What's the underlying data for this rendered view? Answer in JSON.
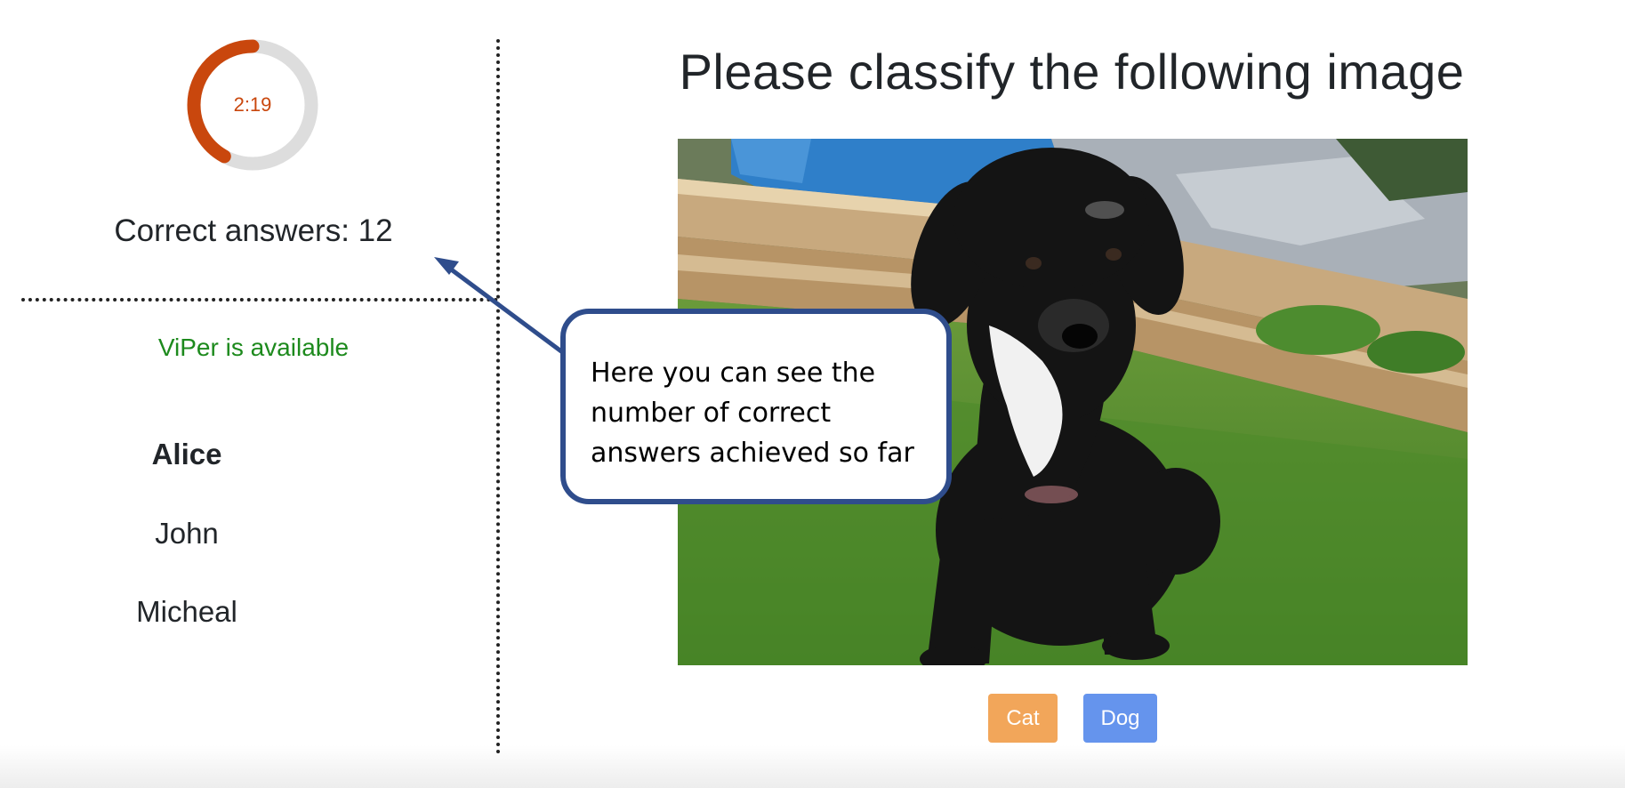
{
  "timer": {
    "remaining": "2:19",
    "fraction_elapsed": 0.42,
    "ring_color": "#c9470d",
    "track_color": "#dddddd"
  },
  "scoreboard": {
    "correct_answers": "Correct answers: 12"
  },
  "status": {
    "text": "ViPer is available",
    "color": "#1d8a1d"
  },
  "users": [
    {
      "name": "Alice",
      "active": true
    },
    {
      "name": "John",
      "active": false
    },
    {
      "name": "Micheal",
      "active": false
    }
  ],
  "main": {
    "title": "Please classify the following image",
    "image_icon": "puppy-photo",
    "buttons": [
      {
        "label": "Cat",
        "color": "#f2a65a"
      },
      {
        "label": "Dog",
        "color": "#6594ed"
      }
    ]
  },
  "callout": {
    "lines": [
      "Here you can see the",
      "number of correct",
      "answers achieved so far"
    ],
    "border_color": "#2f4d8c"
  }
}
